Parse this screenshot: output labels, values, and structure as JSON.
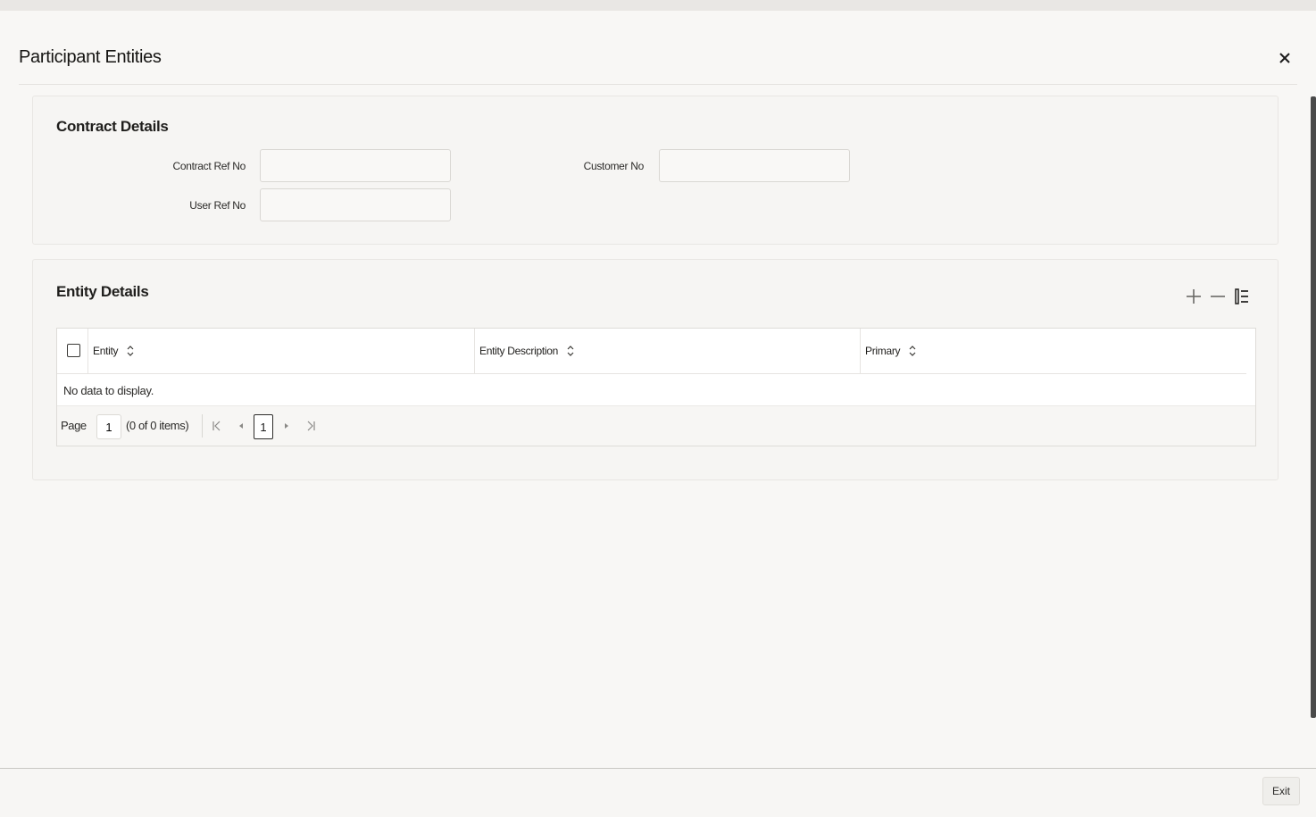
{
  "window": {
    "title": "Participant Entities",
    "close_label": "X"
  },
  "contract_details": {
    "title": "Contract Details",
    "fields": {
      "contract_ref_no": {
        "label": "Contract Ref No",
        "value": ""
      },
      "user_ref_no": {
        "label": "User Ref No",
        "value": ""
      },
      "customer_no": {
        "label": "Customer No",
        "value": ""
      }
    }
  },
  "entity_details": {
    "title": "Entity Details",
    "toolbar": {
      "add_icon": "plus-icon",
      "remove_icon": "minus-icon",
      "columns_icon": "list-settings-icon"
    },
    "table": {
      "columns": [
        "Entity",
        "Entity Description",
        "Primary"
      ],
      "rows": [],
      "empty_message": "No data to display."
    },
    "pager": {
      "page_label": "Page",
      "page_value": "1",
      "items_summary": "(0 of 0 items)",
      "current_page": "1"
    }
  },
  "footer": {
    "exit_label": "Exit"
  }
}
